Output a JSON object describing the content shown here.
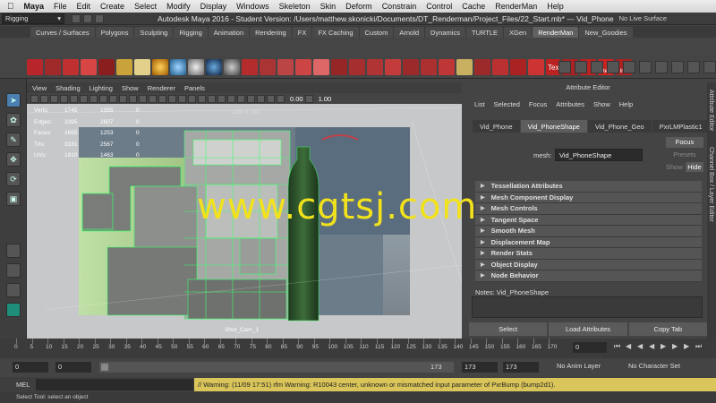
{
  "menubar": {
    "apple": "",
    "app": "Maya",
    "items": [
      "File",
      "Edit",
      "Create",
      "Select",
      "Modify",
      "Display",
      "Windows",
      "Skeleton",
      "Skin",
      "Deform",
      "Constrain",
      "Control",
      "Cache",
      "RenderMan",
      "Help"
    ]
  },
  "titlebar": {
    "mode": "Rigging",
    "title": "Autodesk Maya 2016 - Student Version: /Users/matthew.skonicki/Documents/DT_Renderman/Project_Files/22_Start.mb* --- Vid_Phone",
    "live_surface": "No Live Surface"
  },
  "shelf": {
    "tabs": [
      "Curves / Surfaces",
      "Polygons",
      "Sculpting",
      "Rigging",
      "Animation",
      "Rendering",
      "FX",
      "FX Caching",
      "Custom",
      "Arnold",
      "Dynamics",
      "TURTLE",
      "XGen",
      "RenderMan",
      "New_Goodies"
    ],
    "active_tab": "RenderMan",
    "labels": {
      "tex": "Tex",
      "help": "Help",
      "info": "Info"
    }
  },
  "viewport": {
    "menu": [
      "View",
      "Shading",
      "Lighting",
      "Show",
      "Renderer",
      "Panels"
    ],
    "near": "0.00",
    "far": "1.00",
    "resolution_gate": "1280 x 720",
    "camera": "Shot_Cam_1",
    "hud": [
      {
        "label": "Verts:",
        "a": "1745",
        "b": "1355",
        "c": "0"
      },
      {
        "label": "Edges:",
        "a": "3395",
        "b": "2607",
        "c": "0"
      },
      {
        "label": "Faces:",
        "a": "1655",
        "b": "1253",
        "c": "0"
      },
      {
        "label": "Tris:",
        "a": "3331",
        "b": "2567",
        "c": "0"
      },
      {
        "label": "UVs:",
        "a": "1910",
        "b": "1463",
        "c": "0"
      }
    ]
  },
  "attribute_editor": {
    "title": "Attribute Editor",
    "menu": [
      "List",
      "Selected",
      "Focus",
      "Attributes",
      "Show",
      "Help"
    ],
    "tabs": [
      "Vid_Phone",
      "Vid_PhoneShape",
      "Vid_Phone_Geo",
      "PxrLMPlastic1"
    ],
    "active_tab": "Vid_PhoneShape",
    "mesh_label": "mesh:",
    "mesh_value": "Vid_PhoneShape",
    "focus": "Focus",
    "presets": "Presets",
    "show": "Show",
    "hide": "Hide",
    "sections": [
      "Tessellation Attributes",
      "Mesh Component Display",
      "Mesh Controls",
      "Tangent Space",
      "Smooth Mesh",
      "Displacement Map",
      "Render Stats",
      "Object Display",
      "Node Behavior"
    ],
    "notes_label": "Notes:  Vid_PhoneShape",
    "buttons": [
      "Select",
      "Load Attributes",
      "Copy Tab"
    ]
  },
  "side_tabs": [
    "Attribute Editor",
    "Channel Box / Layer Editor"
  ],
  "timeline": {
    "ticks": [
      "0",
      "5",
      "10",
      "15",
      "20",
      "25",
      "30",
      "35",
      "40",
      "45",
      "50",
      "55",
      "60",
      "65",
      "70",
      "75",
      "80",
      "85",
      "90",
      "95",
      "100",
      "105",
      "110",
      "115",
      "120",
      "125",
      "130",
      "135",
      "140",
      "145",
      "150",
      "155",
      "160",
      "165",
      "170"
    ],
    "current_frame": "0"
  },
  "range": {
    "start": "0",
    "inner_start": "0",
    "slider_start": "0",
    "slider_end": "173",
    "inner_end": "173",
    "end": "173",
    "anim_layer": "No Anim Layer",
    "character_set": "No Character Set"
  },
  "command": {
    "mel": "MEL",
    "warning": "// Warning: (11/09 17:51) rfm Warning: R10043 center, unknown or mismatched input parameter of PxrBump (bump2d1).",
    "help": "Select Tool: select an object"
  },
  "watermark": "www.cgtsj.com",
  "colors": {
    "wireframe": "#3dff6a",
    "watermark": "#f2e21c",
    "warning_bg": "#d9c55a",
    "active_tool": "#4a7fb0"
  }
}
